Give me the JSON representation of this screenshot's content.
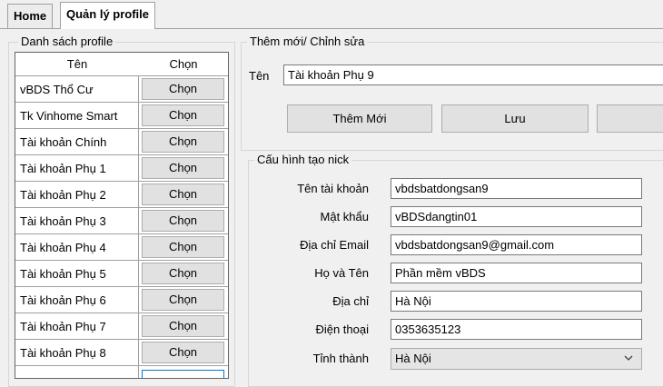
{
  "tabs": [
    {
      "label": "Home"
    },
    {
      "label": "Quản lý profile"
    }
  ],
  "profile_list": {
    "legend": "Danh sách profile",
    "col_name": "Tên",
    "col_select": "Chọn",
    "rows": [
      {
        "name": "vBDS Thổ Cư",
        "button": "Chọn"
      },
      {
        "name": "Tk Vinhome Smart",
        "button": "Chọn"
      },
      {
        "name": "Tài khoản Chính",
        "button": "Chọn"
      },
      {
        "name": "Tài khoản Phụ 1",
        "button": "Chọn"
      },
      {
        "name": "Tài khoản Phụ 2",
        "button": "Chọn"
      },
      {
        "name": "Tài khoản Phụ 3",
        "button": "Chọn"
      },
      {
        "name": "Tài khoản Phụ 4",
        "button": "Chọn"
      },
      {
        "name": "Tài khoản Phụ 5",
        "button": "Chọn"
      },
      {
        "name": "Tài khoản Phụ 6",
        "button": "Chọn"
      },
      {
        "name": "Tài khoản Phụ 7",
        "button": "Chọn"
      },
      {
        "name": "Tài khoản Phụ 8",
        "button": "Chọn"
      }
    ]
  },
  "edit": {
    "legend": "Thêm mới/ Chỉnh sửa",
    "name_label": "Tên",
    "name_value": "Tài khoản Phụ 9",
    "add_button": "Thêm Mới",
    "save_button": "Lưu"
  },
  "nick_config": {
    "legend": "Cấu hình tạo nick",
    "fields": [
      {
        "label": "Tên tài khoản",
        "value": "vbdsbatdongsan9"
      },
      {
        "label": "Mật khẩu",
        "value": "vBDSdangtin01"
      },
      {
        "label": "Địa chỉ Email",
        "value": "vbdsbatdongsan9@gmail.com"
      },
      {
        "label": "Họ và Tên",
        "value": "Phần mềm vBDS"
      },
      {
        "label": "Địa chỉ",
        "value": "Hà Nội"
      },
      {
        "label": "Điện thoại",
        "value": "0353635123"
      }
    ],
    "province_label": "Tỉnh thành",
    "province_value": "Hà Nội"
  }
}
